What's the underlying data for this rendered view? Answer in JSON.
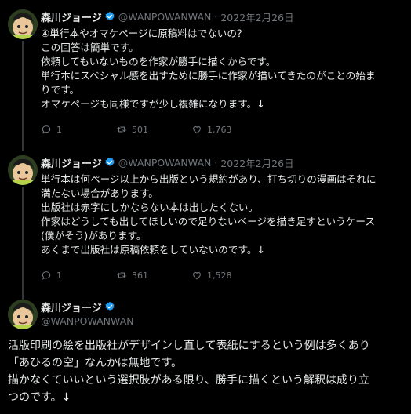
{
  "tweets": [
    {
      "author_name": "森川ジョージ",
      "handle": "@WANPOWANWAN",
      "separator": "·",
      "date": "2022年2月26日",
      "lines": [
        "④単行本やオマケページに原稿料はでないの？",
        "この回答は簡単です。",
        "依頼してもいないものを作家が勝手に描くからです。",
        "単行本にスペシャル感を出すために勝手に作家が描いてきたのがことの始ま",
        "りです。",
        "オマケページも同様ですが少し複雑になります。↓"
      ],
      "reply_count": "1",
      "retweet_count": "501",
      "like_count": "1,763"
    },
    {
      "author_name": "森川ジョージ",
      "handle": "@WANPOWANWAN",
      "separator": "·",
      "date": "2022年2月26日",
      "lines": [
        "単行本は何ページ以上から出版という規約があり、打ち切りの漫画はそれに",
        "満たない場合があります。",
        "出版社は赤字にしかならない本は出したくない。",
        "作家はどうしても出してほしいので足りないページを描き足すというケース",
        "(僕がそう)があります。",
        "あくまで出版社は原稿依頼をしていないのです。↓"
      ],
      "reply_count": "1",
      "retweet_count": "361",
      "like_count": "1,528"
    },
    {
      "author_name": "森川ジョージ",
      "handle": "@WANPOWANWAN",
      "lines": [
        "活版印刷の絵を出版社がデザインし直して表紙にするという例は多くあり",
        "「あひるの空」なんかは無地です。",
        "描かなくていいという選択肢がある限り、勝手に描くという解釈は成り立",
        "つのです。↓"
      ]
    }
  ],
  "icons": {
    "avatar": "avatar-image",
    "verified": "verified-badge-icon",
    "reply": "reply-icon",
    "retweet": "retweet-icon",
    "like": "like-icon"
  },
  "colors": {
    "background": "#000000",
    "text": "#e7e9ea",
    "muted": "#71767b",
    "verified": "#1d9bf0",
    "thread_line": "#333639"
  }
}
